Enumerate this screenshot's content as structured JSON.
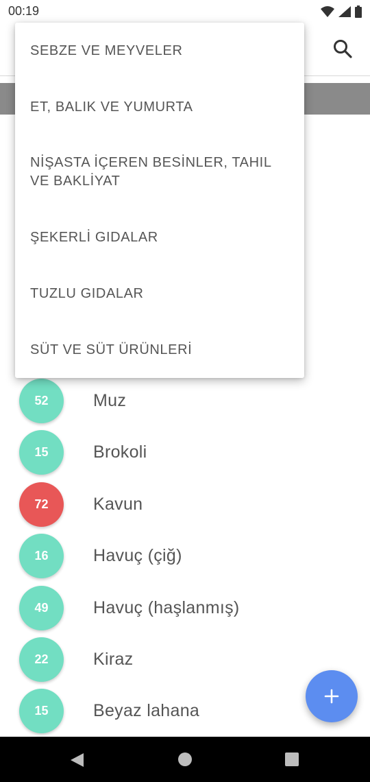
{
  "status_bar": {
    "time": "00:19"
  },
  "menu": {
    "items": [
      {
        "label": "SEBZE VE MEYVELER"
      },
      {
        "label": "ET, BALIK VE YUMURTA"
      },
      {
        "label": "NİŞASTA İÇEREN BESİNLER, TAHIL VE BAKLİYAT"
      },
      {
        "label": "ŞEKERLİ GIDALAR"
      },
      {
        "label": "TUZLU GIDALAR"
      },
      {
        "label": "SÜT VE SÜT ÜRÜNLERİ"
      }
    ]
  },
  "foods": [
    {
      "value": "52",
      "name": "Muz",
      "status_color": "#72dec2"
    },
    {
      "value": "15",
      "name": "Brokoli",
      "status_color": "#72dec2"
    },
    {
      "value": "72",
      "name": "Kavun",
      "status_color": "#e85757"
    },
    {
      "value": "16",
      "name": "Havuç (çiğ)",
      "status_color": "#72dec2"
    },
    {
      "value": "49",
      "name": "Havuç (haşlanmış)",
      "status_color": "#72dec2"
    },
    {
      "value": "22",
      "name": "Kiraz",
      "status_color": "#72dec2"
    },
    {
      "value": "15",
      "name": "Beyaz lahana",
      "status_color": "#72dec2"
    }
  ],
  "colors": {
    "fab": "#5c8df0",
    "low": "#72dec2",
    "high": "#e85757"
  },
  "icons": {
    "search": "search-icon",
    "add": "plus-icon",
    "back": "back-icon",
    "home": "home-icon",
    "recents": "recents-icon"
  }
}
